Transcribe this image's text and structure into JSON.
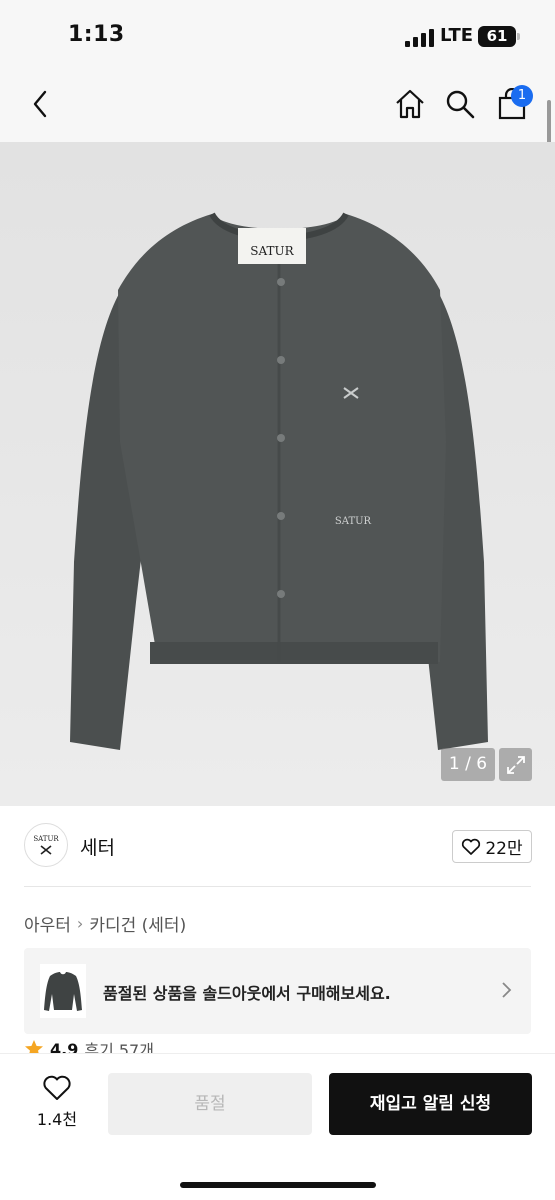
{
  "status_bar": {
    "time": "1:13",
    "network": "LTE",
    "battery": "61"
  },
  "nav": {
    "cart_badge": "1"
  },
  "product": {
    "image_counter": "1 / 6",
    "garment_label": "SATUR",
    "chest_logo": "SATUR"
  },
  "brand": {
    "logo_text": "SATUR",
    "name": "세터",
    "likes": "22만"
  },
  "breadcrumb": {
    "level1": "아우터",
    "level2": "카디건 (세터)"
  },
  "resale_banner": {
    "text": "품절된 상품을 솔드아웃에서 구매해보세요."
  },
  "reviews": {
    "score": "4.9",
    "label": "후기 57개"
  },
  "bottom": {
    "wish_count": "1.4천",
    "soldout_label": "품절",
    "notify_label": "재입고 알림 신청"
  },
  "colors": {
    "accent_badge": "#1a6cf0",
    "star": "#f5a623",
    "primary_button": "#111111"
  }
}
